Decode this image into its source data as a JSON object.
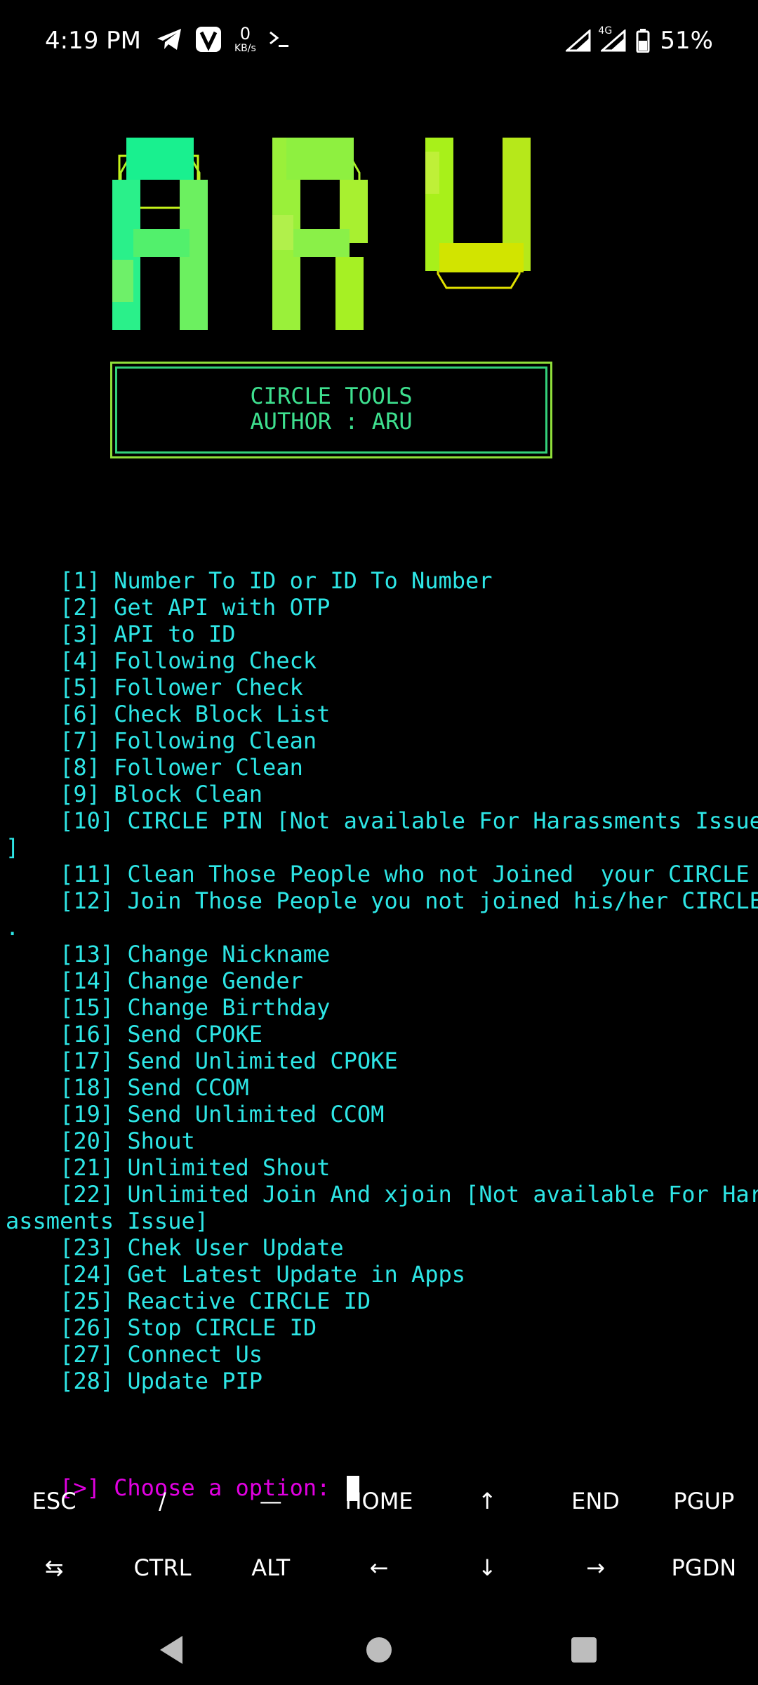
{
  "status_bar": {
    "time": "4:19 PM",
    "speed_value": "0",
    "speed_unit": "KB/s",
    "network": "4G",
    "battery": "51%",
    "icons": [
      "telegram-icon",
      "v-app-icon",
      "terminal-icon",
      "signal-icon",
      "battery-icon"
    ]
  },
  "terminal": {
    "logo_text": "ARU",
    "banner": {
      "line1": "CIRCLE TOOLS",
      "line2": "AUTHOR : ARU"
    },
    "menu_lines": [
      "    [1] Number To ID or ID To Number",
      "    [2] Get API with OTP",
      "    [3] API to ID",
      "    [4] Following Check",
      "    [5] Follower Check",
      "    [6] Check Block List",
      "    [7] Following Clean",
      "    [8] Follower Clean",
      "    [9] Block Clean",
      "    [10] CIRCLE PIN [Not available For Harassments Issue",
      "]",
      "    [11] Clean Those People who not Joined  your CIRCLE",
      "    [12] Join Those People you not joined his/her CIRCLE",
      ".",
      "    [13] Change Nickname",
      "    [14] Change Gender",
      "    [15] Change Birthday",
      "    [16] Send CPOKE",
      "    [17] Send Unlimited CPOKE",
      "    [18] Send CCOM",
      "    [19] Send Unlimited CCOM",
      "    [20] Shout",
      "    [21] Unlimited Shout",
      "    [22] Unlimited Join And xjoin [Not available For Har",
      "assments Issue]",
      "    [23] Chek User Update",
      "    [24] Get Latest Update in Apps",
      "    [25] Reactive CIRCLE ID",
      "    [26] Stop CIRCLE ID",
      "    [27] Connect Us",
      "    [28] Update PIP",
      ""
    ],
    "prompt": "    [>] Choose a option: ",
    "colors": {
      "menu": "#2ee6e6",
      "prompt": "#e100e1",
      "banner": "#3ee08f"
    }
  },
  "extra_keys": {
    "row1": [
      "ESC",
      "/",
      "—",
      "HOME",
      "↑",
      "END",
      "PGUP"
    ],
    "row2": [
      "⇆",
      "CTRL",
      "ALT",
      "←",
      "↓",
      "→",
      "PGDN"
    ]
  },
  "nav_bar": {
    "icons": [
      "back-icon",
      "home-icon",
      "recents-icon"
    ]
  }
}
